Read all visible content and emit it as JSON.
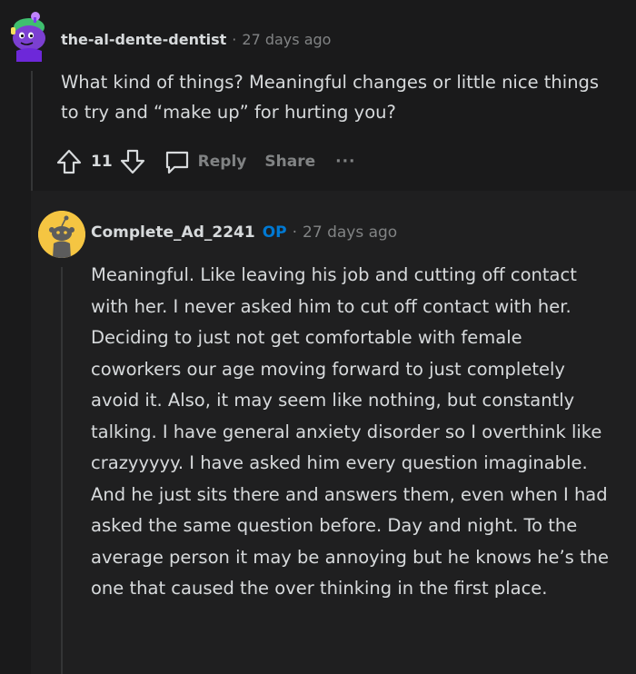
{
  "comments": [
    {
      "author": "the-al-dente-dentist",
      "time": "27 days ago",
      "body": "What kind of things? Meaningful changes or little nice things to try and “make up” for hurting you?",
      "votes": "11",
      "reply_label": "Reply",
      "share_label": "Share",
      "more_label": "···",
      "avatar": "snoo-avatar-purple-icon"
    },
    {
      "author": "Complete_Ad_2241",
      "op_badge": "OP",
      "time": "27 days ago",
      "body": "Meaningful. Like leaving his job and cutting off contact with her. I never asked him to cut off contact with her. Deciding to just not get comfortable with female coworkers our age moving forward to just completely avoid it. Also, it may seem like nothing, but constantly talking. I have general anxiety disorder so I overthink like crazyyyyy. I have asked him every question imaginable. And he just sits there and answers them, even when I had asked the same question before. Day and night. To the average person it may be annoying but he knows he’s the one that caused the over thinking in the first place.",
      "avatar": "snoo-avatar-default-icon"
    }
  ],
  "colors": {
    "background": "#1a1a1b",
    "reply_background": "#1f1f20",
    "text": "#d7dadc",
    "muted": "#818384",
    "op": "#0079d3",
    "avatar2_bg": "#f5c542"
  },
  "separator": "·"
}
